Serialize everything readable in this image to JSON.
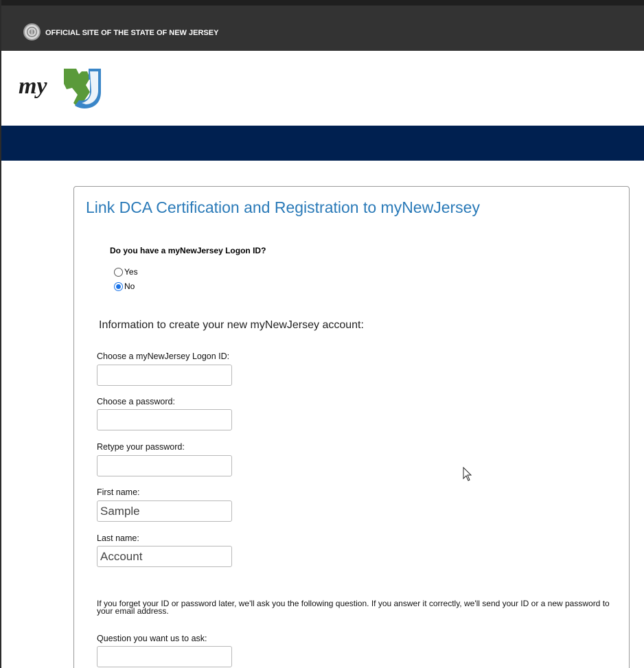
{
  "header": {
    "official_text": "OFFICIAL SITE OF THE STATE OF NEW JERSEY",
    "seal_icon": "nj-state-seal-icon",
    "logo_text": "my",
    "colors": {
      "topbar": "#333333",
      "navband": "#002050",
      "title": "#2a7ab8",
      "logo_green": "#5a9a3a",
      "logo_blue": "#3a86c8"
    }
  },
  "form": {
    "title": "Link DCA Certification and Registration to myNewJersey",
    "question": "Do you have a myNewJersey Logon ID?",
    "options": [
      {
        "label": "Yes",
        "checked": false
      },
      {
        "label": "No",
        "checked": true
      }
    ],
    "info_heading": "Information to create your new myNewJersey account:",
    "fields": {
      "logon_id": {
        "label": "Choose a myNewJersey Logon ID:",
        "value": ""
      },
      "password": {
        "label": "Choose a password:",
        "value": ""
      },
      "retype_password": {
        "label": "Retype your password:",
        "value": ""
      },
      "first_name": {
        "label": "First name:",
        "value": "Sample"
      },
      "last_name": {
        "label": "Last name:",
        "value": "Account"
      },
      "question": {
        "label": "Question you want us to ask:",
        "value": ""
      }
    },
    "note": "If you forget your ID or password later, we'll ask you the following question. If you answer it correctly, we'll send your ID or a new password to your email address."
  }
}
